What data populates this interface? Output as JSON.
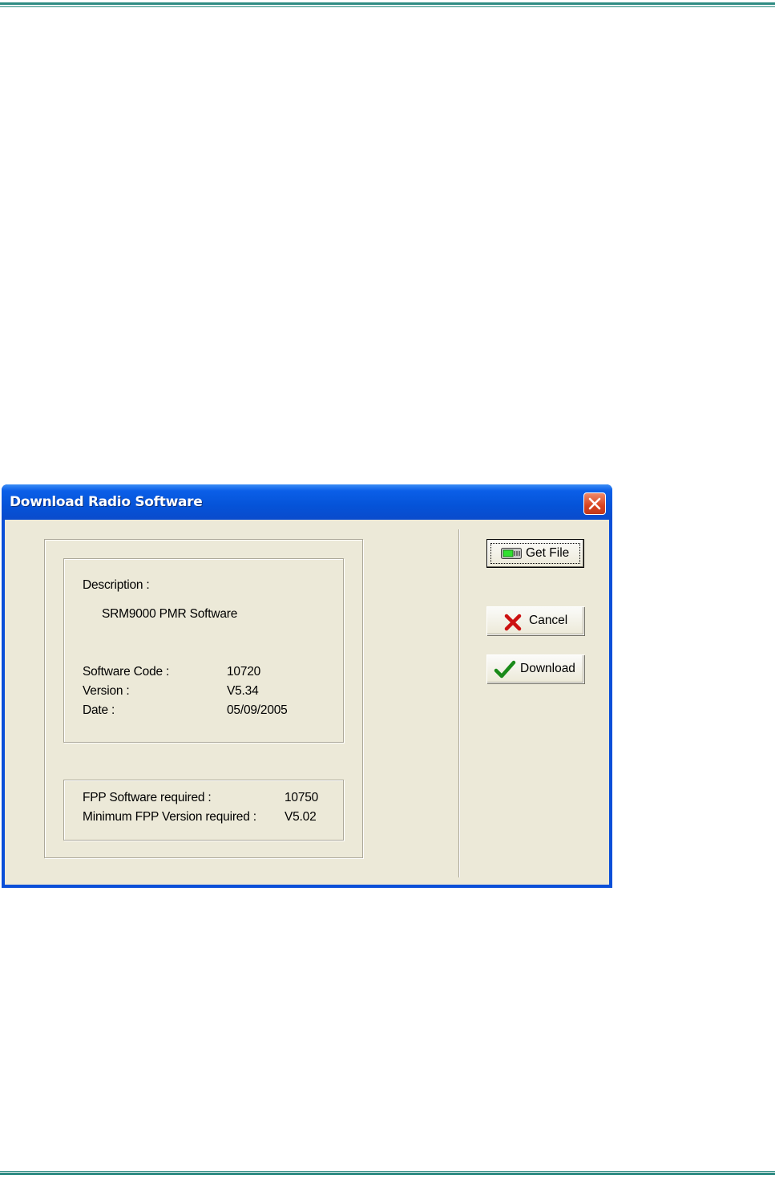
{
  "dialog": {
    "title": "Download Radio Software",
    "close_icon": "close-icon"
  },
  "info": {
    "description_label": "Description :",
    "description_value": "SRM9000 PMR Software",
    "software_code_label": "Software Code :",
    "software_code_value": "10720",
    "version_label": "Version :",
    "version_value": "V5.34",
    "date_label": "Date :",
    "date_value": "05/09/2005"
  },
  "fpp": {
    "software_required_label": "FPP Software required :",
    "software_required_value": "10750",
    "min_version_label": "Minimum FPP Version required :",
    "min_version_value": "V5.02"
  },
  "buttons": {
    "get_file": {
      "label": "Get File",
      "icon": "file-icon"
    },
    "cancel": {
      "label": "Cancel",
      "icon": "red-x-icon"
    },
    "download": {
      "label": "Download",
      "icon": "green-check-icon"
    }
  },
  "colors": {
    "page_rule": "#2e8b82",
    "titlebar": "#0553d8",
    "dialog_face": "#ece9d8",
    "cancel_icon": "#cc1111",
    "download_icon": "#1a8a1a"
  }
}
